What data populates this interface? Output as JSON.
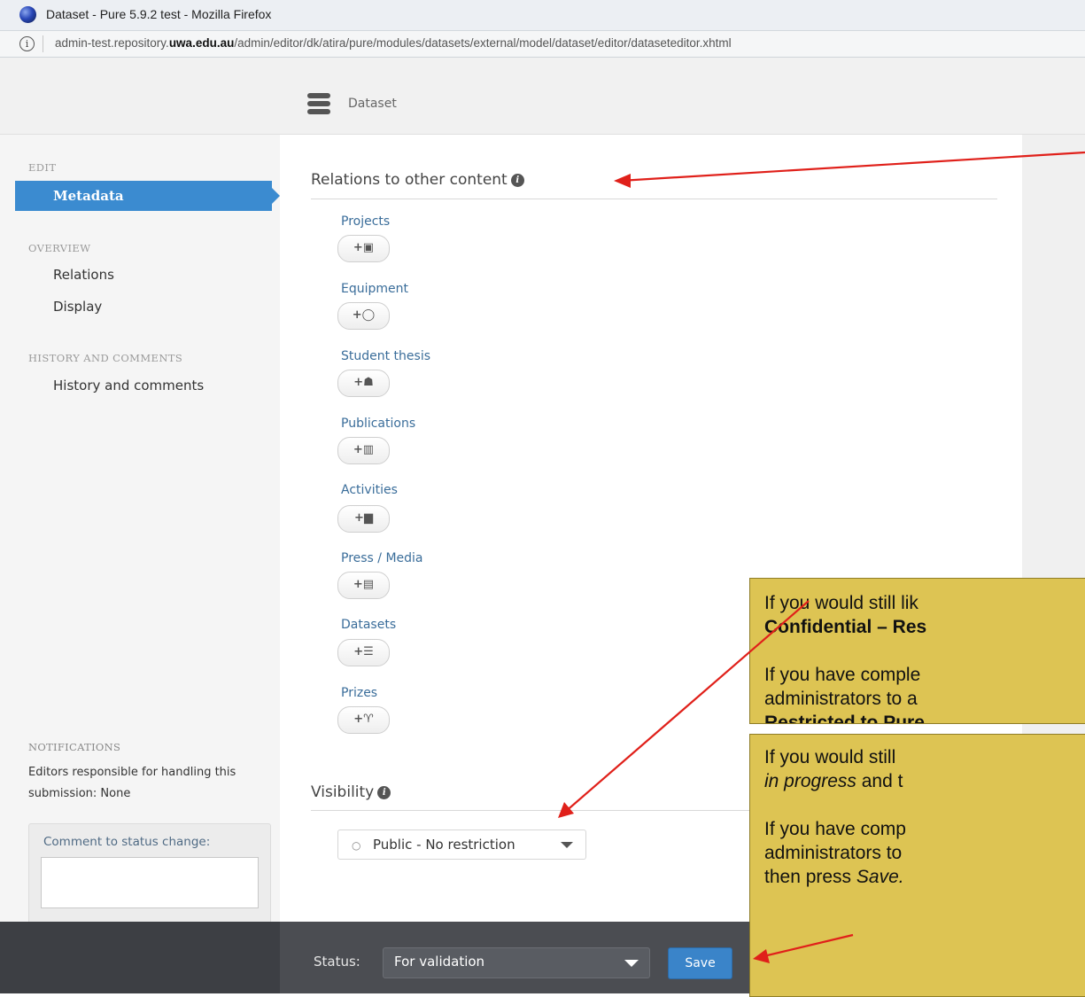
{
  "window": {
    "title": "Dataset - Pure 5.9.2 test - Mozilla Firefox",
    "url_prefix": "admin-test.repository.",
    "url_domain": "uwa.edu.au",
    "url_path": "/admin/editor/dk/atira/pure/modules/datasets/external/model/dataset/editor/dataseteditor.xhtml"
  },
  "header": {
    "label": "Dataset"
  },
  "sidebar": {
    "edit_heading": "EDIT",
    "active_item": "Metadata",
    "overview_heading": "OVERVIEW",
    "overview_items": [
      "Relations",
      "Display"
    ],
    "history_heading": "HISTORY AND COMMENTS",
    "history_item": "History and comments",
    "notifications_heading": "NOTIFICATIONS",
    "editors_text": "Editors responsible for handling this submission: None",
    "comment_label": "Comment to status change:"
  },
  "main": {
    "relations_title": "Relations to other content",
    "relations": [
      {
        "label": "Projects",
        "icon": "+▣"
      },
      {
        "label": "Equipment",
        "icon": "+◯"
      },
      {
        "label": "Student thesis",
        "icon": "+☗"
      },
      {
        "label": "Publications",
        "icon": "+▥"
      },
      {
        "label": "Activities",
        "icon": "+▆"
      },
      {
        "label": "Press / Media",
        "icon": "+▤"
      },
      {
        "label": "Datasets",
        "icon": "+☰"
      },
      {
        "label": "Prizes",
        "icon": "+♈"
      }
    ],
    "visibility_title": "Visibility",
    "visibility_value": "Public - No restriction"
  },
  "bottom": {
    "status_label": "Status:",
    "status_value": "For validation",
    "save_label": "Save"
  },
  "callouts": {
    "c1_line1": "If you would still lik",
    "c1_line2": "Confidential – Res",
    "c1_line3": "If you have comple",
    "c1_line4": "administrators to a",
    "c1_line5": "Restricted to Pure",
    "c2_line1": "If you would still",
    "c2_line2a": "in progress",
    "c2_line2b": " and t",
    "c2_line3": "If you have comp",
    "c2_line4": "administrators to",
    "c2_line5a": "then press ",
    "c2_line5b": "Save."
  },
  "colors": {
    "accent": "#3b8bd0",
    "callout_bg": "#ddc453",
    "arrow": "#e0201a"
  }
}
